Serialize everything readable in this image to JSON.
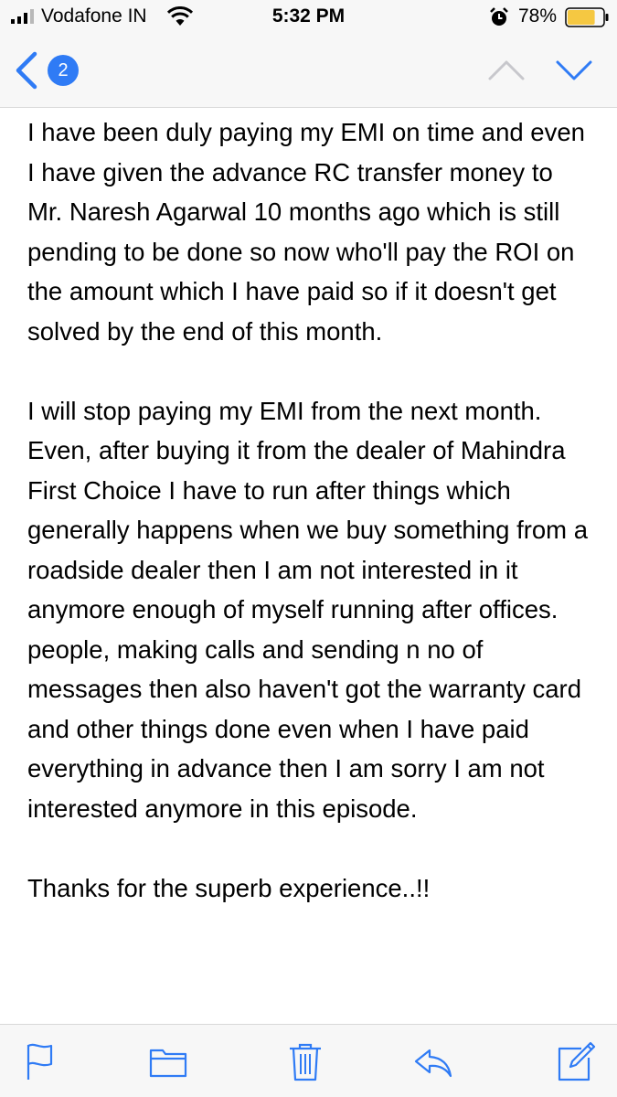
{
  "status_bar": {
    "carrier": "Vodafone IN",
    "time": "5:32 PM",
    "battery_percent": "78%",
    "battery_level": 0.78,
    "icons": [
      "signal-icon",
      "wifi-icon",
      "alarm-icon",
      "battery-icon"
    ]
  },
  "nav": {
    "back_badge_count": "2",
    "icons": [
      "back-chevron-icon",
      "previous-message-icon",
      "next-message-icon"
    ]
  },
  "message": {
    "paragraphs": [
      "I have been duly paying my EMI on time and even I have given the advance RC transfer money to Mr. Naresh Agarwal 10 months ago which is still pending to be done so now who'll pay the ROI on the amount which I have paid so if it doesn't get solved by the end of this month.",
      "I will stop paying my EMI from the next month. Even, after buying it from the dealer of Mahindra First Choice I have to run after things which generally happens when we buy something from a roadside dealer then I am not interested in it anymore enough of myself running after offices. people, making calls and sending n no of messages then also haven't got the warranty card and other things done even when I have paid everything in advance then I am sorry I am not interested anymore in this episode.",
      "Thanks for the superb experience..!!"
    ]
  },
  "toolbar": {
    "icons": [
      "flag-icon",
      "folder-icon",
      "trash-icon",
      "reply-icon",
      "compose-icon"
    ]
  },
  "colors": {
    "accent": "#2f7bf5",
    "bar_background": "#f7f7f7",
    "battery_fill": "#f5c842",
    "disabled_gray": "#c7c7cc"
  }
}
